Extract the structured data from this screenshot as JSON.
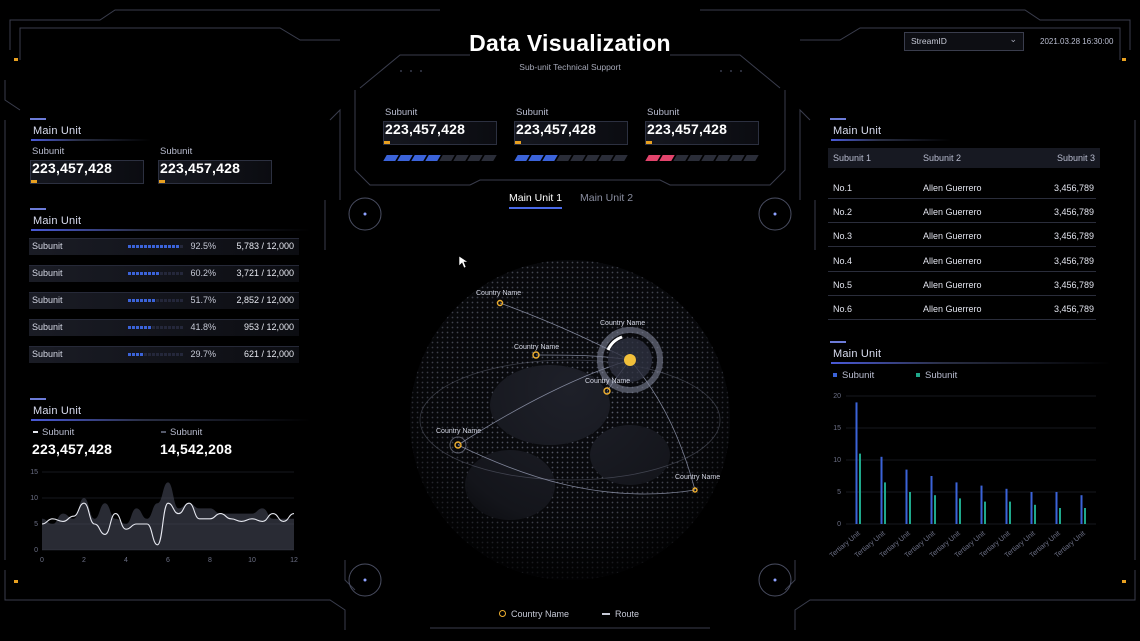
{
  "header": {
    "title": "Data Visualization",
    "subtitle": "Sub-unit Technical Support",
    "stream_select": "StreamID",
    "datetime": "2021.03.28 16:30:00"
  },
  "top_center": {
    "cards": [
      {
        "label": "Subunit",
        "value": "223,457,428",
        "progress": 0.5,
        "color": "#3b63d9"
      },
      {
        "label": "Subunit",
        "value": "223,457,428",
        "progress": 0.4,
        "color": "#3b63d9"
      },
      {
        "label": "Subunit",
        "value": "223,457,428",
        "progress": 0.25,
        "color": "#e2446c"
      }
    ],
    "tabs": [
      "Main Unit 1",
      "Main Unit 2"
    ],
    "active_tab": 0
  },
  "left_top": {
    "title": "Main Unit",
    "cards": [
      {
        "label": "Subunit",
        "value": "223,457,428"
      },
      {
        "label": "Subunit",
        "value": "223,457,428"
      }
    ]
  },
  "left_mid": {
    "title": "Main Unit",
    "rows": [
      {
        "label": "Subunit",
        "pct": "92.5%",
        "fraction": 0.925,
        "value": "5,783 / 12,000"
      },
      {
        "label": "Subunit",
        "pct": "60.2%",
        "fraction": 0.602,
        "value": "3,721 / 12,000"
      },
      {
        "label": "Subunit",
        "pct": "51.7%",
        "fraction": 0.517,
        "value": "2,852 / 12,000"
      },
      {
        "label": "Subunit",
        "pct": "41.8%",
        "fraction": 0.418,
        "value": "953 / 12,000"
      },
      {
        "label": "Subunit",
        "pct": "29.7%",
        "fraction": 0.297,
        "value": "621 / 12,000"
      }
    ]
  },
  "left_bottom": {
    "title": "Main Unit",
    "legend": [
      {
        "label": "Subunit",
        "value": "223,457,428",
        "color": "#e6e8f0"
      },
      {
        "label": "Subunit",
        "value": "14,542,208",
        "color": "#555a6b"
      }
    ]
  },
  "chart_data": [
    {
      "type": "line",
      "x": [
        0,
        0.5,
        1,
        1.5,
        2,
        2.5,
        3,
        3.5,
        4,
        4.5,
        5,
        5.5,
        6,
        6.5,
        7,
        7.5,
        8,
        8.5,
        9,
        9.5,
        10,
        10.5,
        11,
        11.5,
        12
      ],
      "series": [
        {
          "values": [
            5,
            6,
            5.5,
            6.5,
            9,
            5,
            3,
            7,
            4,
            5,
            5,
            1,
            9,
            7,
            9,
            6,
            6,
            7,
            6,
            5.5,
            6,
            5.5,
            7,
            5.5,
            7
          ],
          "color": "#e6e8f0"
        },
        {
          "values": [
            6,
            5,
            7,
            6,
            10,
            6,
            9,
            6,
            5,
            8,
            6,
            9,
            13,
            8,
            9,
            8,
            8,
            7,
            7,
            7,
            7,
            8,
            6,
            6,
            6
          ],
          "color": "#4a4e5e"
        }
      ],
      "xlim": [
        0,
        12
      ],
      "ylim": [
        0,
        15
      ],
      "xticks": [
        0,
        2,
        4,
        6,
        8,
        10,
        12
      ],
      "yticks": [
        0,
        5,
        10,
        15
      ]
    },
    {
      "type": "bar",
      "categories": [
        "Tertiary Unit",
        "Tertiary Unit",
        "Tertiary Unit",
        "Tertiary Unit",
        "Tertiary Unit",
        "Tertiary Unit",
        "Tertiary Unit",
        "Tertiary Unit",
        "Tertiary Unit",
        "Tertiary Unit"
      ],
      "series": [
        {
          "name": "Subunit",
          "values": [
            19,
            10.5,
            8.5,
            7.5,
            6.5,
            6,
            5.5,
            5,
            5,
            4.5
          ],
          "color": "#3b63d9"
        },
        {
          "name": "Subunit",
          "values": [
            11,
            6.5,
            5,
            4.5,
            4,
            3.5,
            3.5,
            3,
            2.5,
            2.5
          ],
          "color": "#1fa88b"
        }
      ],
      "ylim": [
        0,
        20
      ],
      "yticks": [
        0,
        5,
        10,
        15,
        20
      ]
    }
  ],
  "right_top": {
    "title": "Main Unit",
    "columns": [
      "Subunit 1",
      "Subunit 2",
      "Subunit 3"
    ],
    "rows": [
      {
        "rank": "No.1",
        "name": "Allen Guerrero",
        "value": "3,456,789"
      },
      {
        "rank": "No.2",
        "name": "Allen Guerrero",
        "value": "3,456,789"
      },
      {
        "rank": "No.3",
        "name": "Allen Guerrero",
        "value": "3,456,789"
      },
      {
        "rank": "No.4",
        "name": "Allen Guerrero",
        "value": "3,456,789"
      },
      {
        "rank": "No.5",
        "name": "Allen Guerrero",
        "value": "3,456,789"
      },
      {
        "rank": "No.6",
        "name": "Allen Guerrero",
        "value": "3,456,789"
      }
    ]
  },
  "right_bottom": {
    "title": "Main Unit",
    "legend": [
      "Subunit",
      "Subunit"
    ]
  },
  "globe": {
    "labels": [
      "Country Name",
      "Country Name",
      "Country Name",
      "Country Name",
      "Country Name",
      "Country Name"
    ],
    "legend": {
      "country": "Country Name",
      "route": "Route"
    }
  }
}
